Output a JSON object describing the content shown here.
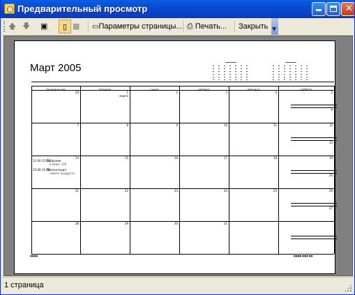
{
  "window": {
    "title": "Предварительный просмотр"
  },
  "toolbar": {
    "page_setup_label": "Параметры страницы...",
    "print_label": "Печать...",
    "close_label": "Закрыть"
  },
  "calendar": {
    "month_title": "Март 2005",
    "weekdays": [
      "понедельник",
      "вторник",
      "среда",
      "четверг",
      "пятница",
      "суббота"
    ],
    "weeks": [
      {
        "days": [
          "28",
          "1 марта",
          "2",
          "3",
          "4",
          "5"
        ],
        "sunday": "6"
      },
      {
        "days": [
          "7",
          "8",
          "9",
          "10",
          "11",
          "12"
        ],
        "sunday": "13"
      },
      {
        "days": [
          "14",
          "15",
          "16",
          "17",
          "18",
          "19"
        ],
        "sunday": "20"
      },
      {
        "days": [
          "21",
          "22",
          "23",
          "24",
          "25",
          "26"
        ],
        "sunday": "27"
      },
      {
        "days": [
          "28",
          "29",
          "30",
          "31",
          "",
          ""
        ],
        "sunday": ""
      }
    ],
    "events": [
      {
        "time": "11:00",
        "end": "12:00",
        "title": "Собрание",
        "sub": "в комн. 105"
      },
      {
        "time": "13:00",
        "end": "15:00",
        "title": "Презентация",
        "sub": "нового продукта"
      }
    ]
  },
  "status": {
    "page_count": "1 страница"
  }
}
